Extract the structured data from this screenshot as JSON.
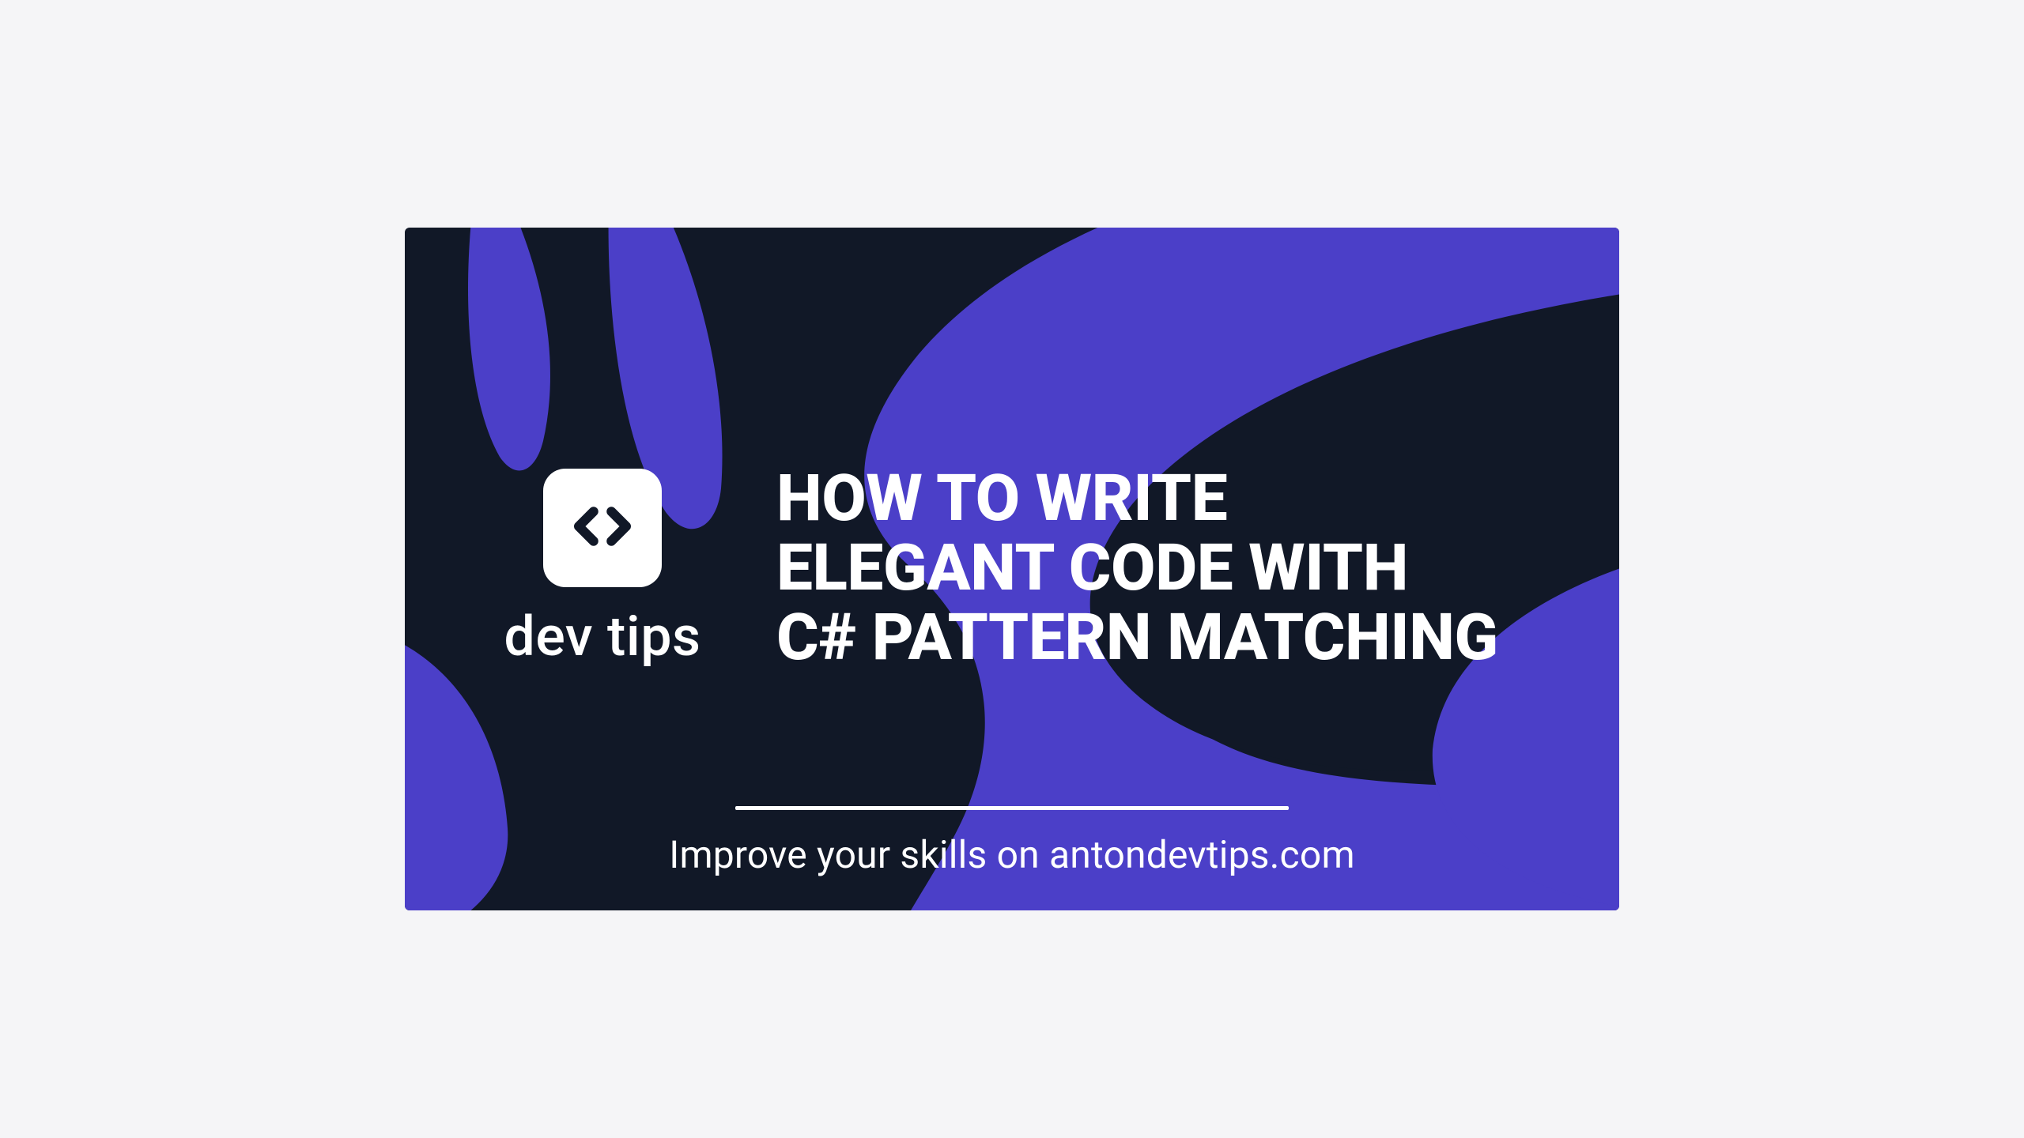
{
  "logo": {
    "text": "dev tips",
    "icon_name": "code-icon"
  },
  "headline": "HOW TO WRITE\nELEGANT CODE WITH\nC# PATTERN MATCHING",
  "tagline": "Improve your skills on antondevtips.com",
  "colors": {
    "bg_dark": "#111827",
    "accent": "#4B3FC8",
    "text": "#ffffff"
  }
}
